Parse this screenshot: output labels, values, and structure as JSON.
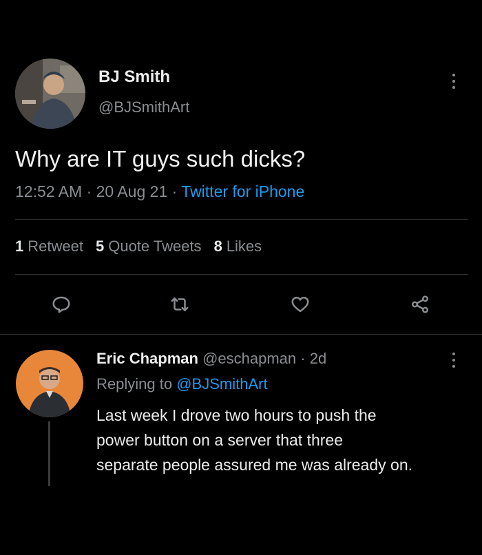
{
  "main_tweet": {
    "author_name": "BJ Smith",
    "author_handle": "@BJSmithArt",
    "text": "Why are IT guys such dicks?",
    "time": "12:52 AM",
    "date": "20 Aug 21",
    "source": "Twitter for iPhone",
    "separator": "·",
    "stats": {
      "retweets_count": "1",
      "retweets_label": "Retweet",
      "quotes_count": "5",
      "quotes_label": "Quote Tweets",
      "likes_count": "8",
      "likes_label": "Likes"
    },
    "actions": [
      "reply-icon",
      "retweet-icon",
      "like-icon",
      "share-icon"
    ]
  },
  "reply": {
    "author_name": "Eric Chapman",
    "author_handle": "@eschapman",
    "age": "2d",
    "separator": "·",
    "replying_prefix": "Replying to",
    "replying_to": "@BJSmithArt",
    "text_lines": [
      "Last week I drove two hours to push the",
      "power button on a server that three",
      "separate people assured me was already on."
    ]
  },
  "colors": {
    "background": "#000000",
    "text": "#e7e9ea",
    "muted": "#8a8d91",
    "link": "#1d9bf0",
    "divider": "#2f3336"
  }
}
